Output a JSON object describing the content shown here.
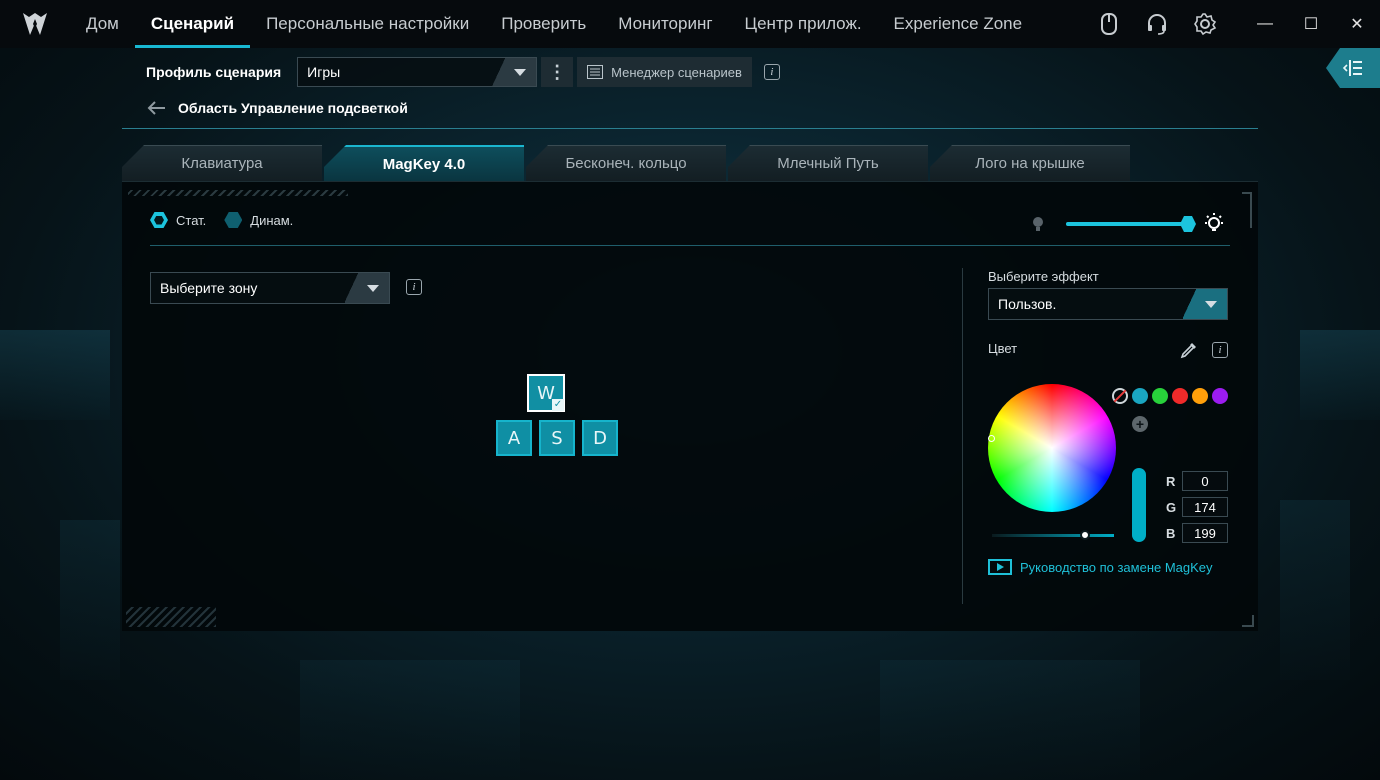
{
  "nav": {
    "items": [
      "Дом",
      "Сценарий",
      "Персональные настройки",
      "Проверить",
      "Мониторинг",
      "Центр прилож.",
      "Experience Zone"
    ],
    "active_index": 1
  },
  "top_icons": [
    "mouse-icon",
    "headset-icon",
    "gear-icon"
  ],
  "window": {
    "minimize": "—",
    "maximize": "☐",
    "close": "✕"
  },
  "profile": {
    "label": "Профиль сценария",
    "selected": "Игры",
    "manager_label": "Менеджер сценариев"
  },
  "breadcrumb": {
    "title": "Область Управление подсветкой"
  },
  "tabs": [
    "Клавиатура",
    "MagKey 4.0",
    "Бесконеч. кольцо",
    "Млечный Путь",
    "Лого на крышке"
  ],
  "active_tab": 1,
  "mode": {
    "static_label": "Стат.",
    "dynamic_label": "Динам.",
    "selected": "static"
  },
  "brightness": {
    "level_pct": 100
  },
  "zone": {
    "placeholder": "Выберите зону"
  },
  "keys": [
    {
      "label": "W",
      "selected": true
    },
    {
      "label": "A",
      "selected": false
    },
    {
      "label": "S",
      "selected": false
    },
    {
      "label": "D",
      "selected": false
    }
  ],
  "effect": {
    "label": "Выберите эффект",
    "selected": "Пользов."
  },
  "color": {
    "label": "Цвет",
    "presets": [
      "none",
      "#1aa6c2",
      "#28d13b",
      "#f02a2a",
      "#ff9f0a",
      "#9c1cf0"
    ],
    "r_label": "R",
    "g_label": "G",
    "b_label": "B",
    "r": "0",
    "g": "174",
    "b": "199",
    "hex": "#00aec7"
  },
  "guide_link": "Руководство по замене MagKey",
  "accent": "#18b8d2"
}
